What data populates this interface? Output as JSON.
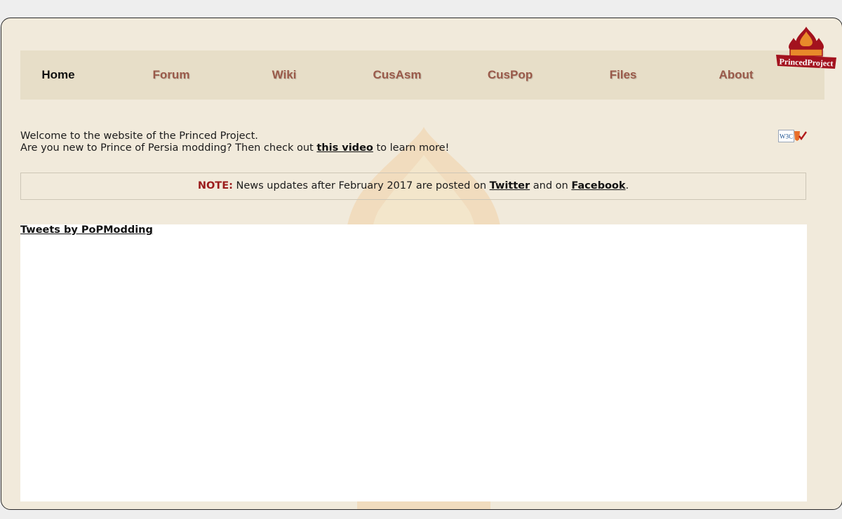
{
  "nav": {
    "items": [
      {
        "label": "Home",
        "active": true
      },
      {
        "label": "Forum",
        "active": false
      },
      {
        "label": "Wiki",
        "active": false
      },
      {
        "label": "CusAsm",
        "active": false
      },
      {
        "label": "CusPop",
        "active": false
      },
      {
        "label": "Files",
        "active": false
      },
      {
        "label": "About",
        "active": false
      }
    ]
  },
  "logo": {
    "text": "PrincedProject",
    "icon": "princed-palace-logo"
  },
  "welcome": {
    "line1": "Welcome to the website of the Princed Project.",
    "line2_before": "Are you new to Prince of Persia modding? Then check out ",
    "line2_link": "this video",
    "line2_after": " to learn more!"
  },
  "w3c_badge": {
    "text": "W3C",
    "icon": "w3c-html5-valid-icon"
  },
  "note": {
    "label": "NOTE:",
    "text_before": " News updates after February 2017 are posted on ",
    "twitter_link": "Twitter",
    "text_middle": " and on ",
    "facebook_link": "Facebook",
    "text_after": "."
  },
  "tweets": {
    "link": "Tweets by PoPModding"
  },
  "colors": {
    "page_bg": "#f1eadb",
    "nav_bg": "#e7dec8",
    "nav_text": "#9a5a4a",
    "note_label": "#9b1c1c",
    "logo_red": "#a3121e"
  }
}
